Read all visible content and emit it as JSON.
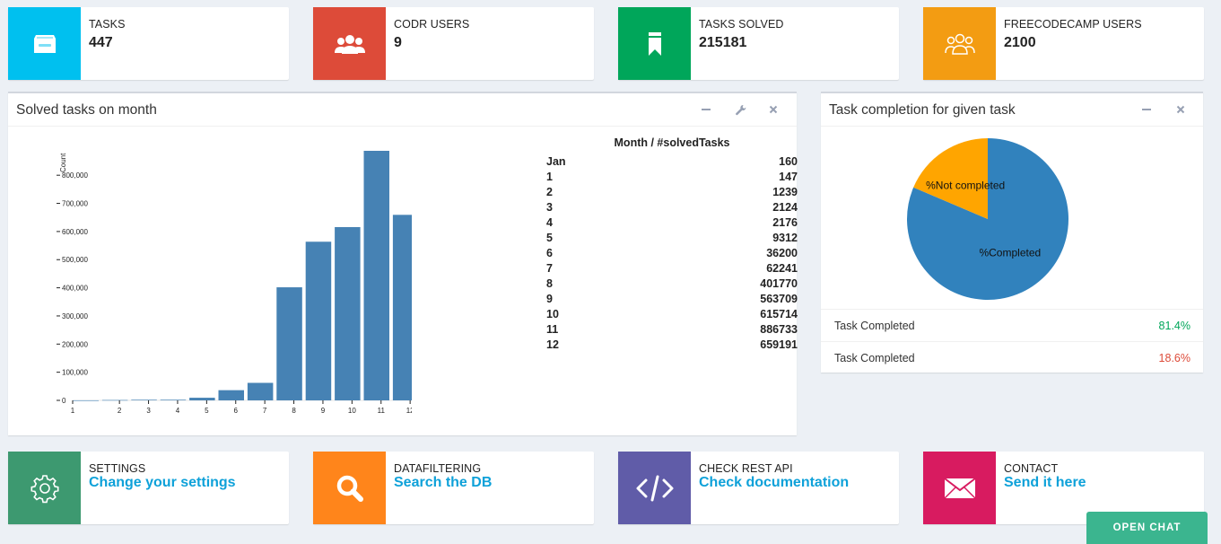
{
  "stats": [
    {
      "label": "TASKS",
      "value": "447",
      "color": "#00c0ef",
      "icon": "inbox-icon"
    },
    {
      "label": "CODR USERS",
      "value": "9",
      "color": "#dd4b39",
      "icon": "users-icon"
    },
    {
      "label": "TASKS SOLVED",
      "value": "215181",
      "color": "#00a65a",
      "icon": "bookmark-icon"
    },
    {
      "label": "FREECODECAMP USERS",
      "value": "2100",
      "color": "#f39c12",
      "icon": "users-outline-icon"
    }
  ],
  "solved_panel": {
    "title": "Solved tasks on month",
    "y_axis_label": "Count",
    "table_header": "Month / #solvedTasks",
    "rows": [
      {
        "month": "Jan",
        "count": "160"
      },
      {
        "month": "1",
        "count": "147"
      },
      {
        "month": "2",
        "count": "1239"
      },
      {
        "month": "3",
        "count": "2124"
      },
      {
        "month": "4",
        "count": "2176"
      },
      {
        "month": "5",
        "count": "9312"
      },
      {
        "month": "6",
        "count": "36200"
      },
      {
        "month": "7",
        "count": "62241"
      },
      {
        "month": "8",
        "count": "401770"
      },
      {
        "month": "9",
        "count": "563709"
      },
      {
        "month": "10",
        "count": "615714"
      },
      {
        "month": "11",
        "count": "886733"
      },
      {
        "month": "12",
        "count": "659191"
      }
    ]
  },
  "completion_panel": {
    "title": "Task completion for given task",
    "legend": [
      {
        "label": "Task Completed",
        "value": "81.4%",
        "color": "#00a65a"
      },
      {
        "label": "Task Completed",
        "value": "18.6%",
        "color": "#dd4b39"
      }
    ]
  },
  "actions": [
    {
      "label": "SETTINGS",
      "link": "Change your settings",
      "color": "#3d9970",
      "icon": "gear-icon"
    },
    {
      "label": "DATAFILTERING",
      "link": "Search the DB",
      "color": "#ff851b",
      "icon": "search-icon"
    },
    {
      "label": "CHECK REST API",
      "link": "Check documentation",
      "color": "#605ca8",
      "icon": "code-icon"
    },
    {
      "label": "CONTACT",
      "link": "Send it here",
      "color": "#d81b60",
      "icon": "envelope-icon"
    }
  ],
  "chat": {
    "label": "OPEN CHAT"
  },
  "chart_data": [
    {
      "type": "bar",
      "ylabel": "Count",
      "categories": [
        "1",
        "2",
        "3",
        "4",
        "5",
        "6",
        "7",
        "8",
        "9",
        "10",
        "11",
        "12"
      ],
      "values": [
        147,
        1239,
        2124,
        2176,
        9312,
        36200,
        62241,
        401770,
        563709,
        615714,
        886733,
        659191
      ],
      "yticks": [
        0,
        100000,
        200000,
        300000,
        400000,
        500000,
        600000,
        700000,
        800000
      ],
      "ytick_labels": [
        "0",
        "100,000",
        "200,000",
        "300,000",
        "400,000",
        "500,000",
        "600,000",
        "700,000",
        "800,000"
      ],
      "ylim": [
        0,
        886733
      ],
      "bar_color": "#4682b4"
    },
    {
      "type": "pie",
      "slices": [
        {
          "label": "%Completed",
          "value": 81.4,
          "color": "#3182bd"
        },
        {
          "label": "%Not completed",
          "value": 18.6,
          "color": "#ffa500"
        }
      ]
    }
  ]
}
